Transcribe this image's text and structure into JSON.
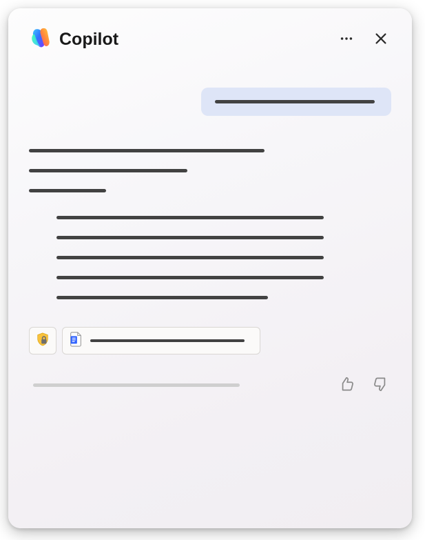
{
  "header": {
    "title": "Copilot",
    "more_label": "More options",
    "close_label": "Close"
  },
  "chat": {
    "user_message": "(redacted user prompt)",
    "reply_lines": [
      "line",
      "line",
      "line"
    ],
    "reply_indented_lines": [
      "line",
      "line",
      "line",
      "line",
      "line"
    ]
  },
  "footer": {
    "security_chip_label": "Sensitivity",
    "reference_chip_label": "1 reference",
    "footer_text": "(secondary info)",
    "like_label": "Like",
    "dislike_label": "Dislike"
  }
}
